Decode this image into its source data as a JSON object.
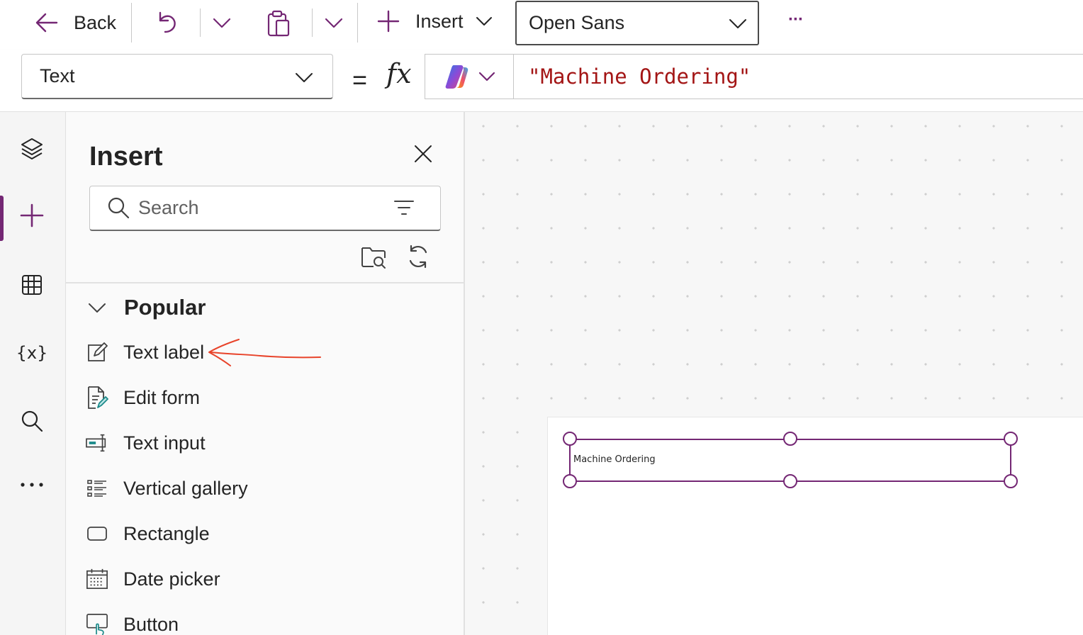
{
  "toolbar": {
    "back_label": "Back",
    "insert_label": "Insert",
    "font_value": "Open Sans",
    "more_label": "···"
  },
  "formula_bar": {
    "property_value": "Text",
    "equals": "=",
    "fx": "fx",
    "formula": "\"Machine Ordering\""
  },
  "rail": {
    "items": [
      "tree-view",
      "insert",
      "data",
      "variables",
      "search",
      "more"
    ]
  },
  "insert_pane": {
    "title": "Insert",
    "search_placeholder": "Search",
    "section": "Popular",
    "items": [
      {
        "label": "Text label",
        "icon": "pencil-edit-icon"
      },
      {
        "label": "Edit form",
        "icon": "form-icon"
      },
      {
        "label": "Text input",
        "icon": "text-input-icon"
      },
      {
        "label": "Vertical gallery",
        "icon": "gallery-icon"
      },
      {
        "label": "Rectangle",
        "icon": "rectangle-icon"
      },
      {
        "label": "Date picker",
        "icon": "calendar-icon"
      },
      {
        "label": "Button",
        "icon": "button-icon"
      }
    ]
  },
  "canvas": {
    "selected_label_text": "Machine Ordering"
  },
  "colors": {
    "accent": "#742774",
    "formula_text": "#a31515",
    "annotation": "#e8432a"
  }
}
